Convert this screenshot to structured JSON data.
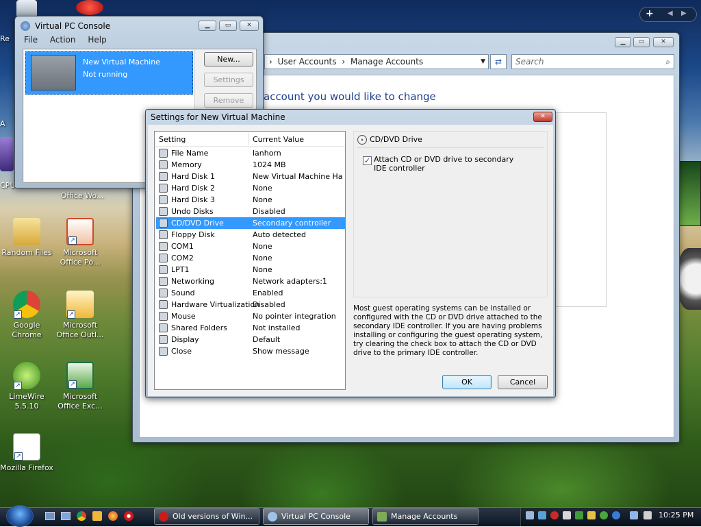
{
  "colors": {
    "accent": "#3399ff",
    "title_bar": "#b6c9dc",
    "taskbar": "#0a1524"
  },
  "desktop_icons": [
    {
      "label": "Re",
      "icon": "folder-icon"
    },
    {
      "label": "CPU",
      "icon": "gadget-icon"
    },
    {
      "label": "A",
      "icon": "app-icon"
    },
    {
      "label": "Office Wo...",
      "icon": "office-icon"
    },
    {
      "label": "Random Files",
      "icon": "folder-icon"
    },
    {
      "label": "Microsoft Office Po...",
      "icon": "powerpoint-icon"
    },
    {
      "label": "Google Chrome",
      "icon": "chrome-icon"
    },
    {
      "label": "Microsoft Office Outl...",
      "icon": "outlook-icon"
    },
    {
      "label": "LimeWire 5.5.10",
      "icon": "limewire-icon"
    },
    {
      "label": "Microsoft Office Exc...",
      "icon": "excel-icon"
    },
    {
      "label": "Mozilla Firefox",
      "icon": "firefox-icon"
    }
  ],
  "sidebar_controls": {
    "add": "+"
  },
  "vpc": {
    "title": "Virtual PC Console",
    "menu": [
      "File",
      "Action",
      "Help"
    ],
    "vm_name": "New Virtual Machine",
    "vm_status": "Not running",
    "buttons": {
      "new": "New...",
      "settings": "Settings",
      "remove": "Remove"
    }
  },
  "accounts": {
    "breadcrumb": [
      "User Accounts",
      "Manage Accounts"
    ],
    "search_placeholder": "Search",
    "heading": "account you would like to change"
  },
  "settings": {
    "title": "Settings for New Virtual Machine",
    "col_setting": "Setting",
    "col_value": "Current Value",
    "rows": [
      {
        "name": "File Name",
        "value": "lanhorn"
      },
      {
        "name": "Memory",
        "value": "1024 MB"
      },
      {
        "name": "Hard Disk 1",
        "value": "New Virtual Machine Har..."
      },
      {
        "name": "Hard Disk 2",
        "value": "None"
      },
      {
        "name": "Hard Disk 3",
        "value": "None"
      },
      {
        "name": "Undo Disks",
        "value": "Disabled"
      },
      {
        "name": "CD/DVD Drive",
        "value": "Secondary controller"
      },
      {
        "name": "Floppy Disk",
        "value": "Auto detected"
      },
      {
        "name": "COM1",
        "value": "None"
      },
      {
        "name": "COM2",
        "value": "None"
      },
      {
        "name": "LPT1",
        "value": "None"
      },
      {
        "name": "Networking",
        "value": "Network adapters:1"
      },
      {
        "name": "Sound",
        "value": "Enabled"
      },
      {
        "name": "Hardware Virtualization",
        "value": "Disabled"
      },
      {
        "name": "Mouse",
        "value": "No pointer integration"
      },
      {
        "name": "Shared Folders",
        "value": "Not installed"
      },
      {
        "name": "Display",
        "value": "Default"
      },
      {
        "name": "Close",
        "value": "Show message"
      }
    ],
    "selected_index": 6,
    "group_title": "CD/DVD Drive",
    "checkbox_label": "Attach CD or DVD drive to secondary IDE controller",
    "checkbox_checked": true,
    "description": "Most guest operating systems can be installed or configured with the CD or DVD drive attached to the secondary IDE controller. If you are having problems installing or configuring the guest operating system, try clearing the check box to attach the CD or DVD drive to the primary IDE controller.",
    "ok": "OK",
    "cancel": "Cancel"
  },
  "taskbar": {
    "items": [
      "Old versions of Win...",
      "Virtual PC Console",
      "Manage Accounts"
    ],
    "clock": "10:25 PM"
  }
}
